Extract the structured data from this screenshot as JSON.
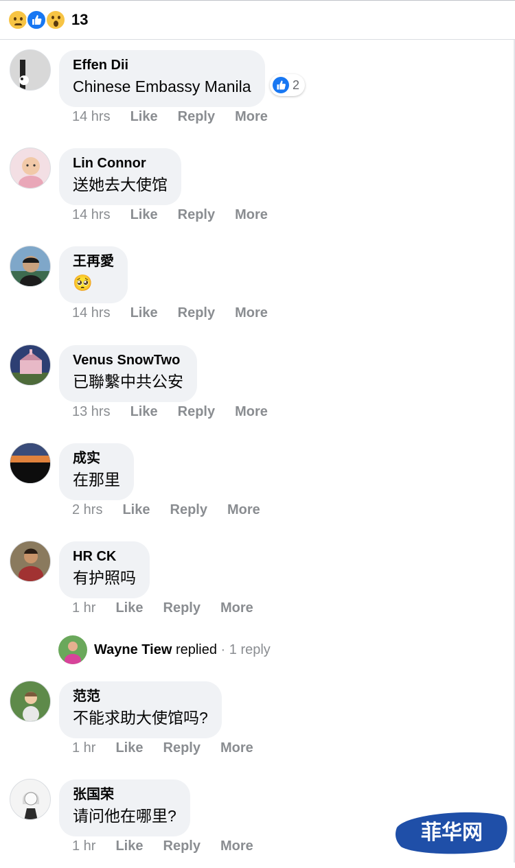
{
  "reactions": {
    "icons": [
      "sad-icon",
      "like-icon",
      "wow-icon"
    ],
    "count": "13"
  },
  "comments": [
    {
      "name": "Effen Dii",
      "text": "Chinese Embassy Manila",
      "time": "14 hrs",
      "like": "Like",
      "reply": "Reply",
      "more": "More",
      "reaction_count": "2"
    },
    {
      "name": "Lin Connor",
      "text": "送她去大使馆",
      "time": "14 hrs",
      "like": "Like",
      "reply": "Reply",
      "more": "More"
    },
    {
      "name": "王再愛",
      "text": "🥺",
      "time": "14 hrs",
      "like": "Like",
      "reply": "Reply",
      "more": "More"
    },
    {
      "name": "Venus SnowTwo",
      "text": "已聯繫中共公安",
      "time": "13 hrs",
      "like": "Like",
      "reply": "Reply",
      "more": "More"
    },
    {
      "name": "成实",
      "text": "在那里",
      "time": "2 hrs",
      "like": "Like",
      "reply": "Reply",
      "more": "More"
    },
    {
      "name": "HR CK",
      "text": "有护照吗",
      "time": "1 hr",
      "like": "Like",
      "reply": "Reply",
      "more": "More"
    },
    {
      "name": "范范",
      "text": "不能求助大使馆吗?",
      "time": "1 hr",
      "like": "Like",
      "reply": "Reply",
      "more": "More"
    },
    {
      "name": "张国荣",
      "text": "请问他在哪里?",
      "time": "1 hr",
      "like": "Like",
      "reply": "Reply",
      "more": "More"
    }
  ],
  "reply_thread": {
    "name": "Wayne Tiew",
    "action": "replied",
    "sep": "·",
    "count": "1 reply"
  },
  "watermark": {
    "text": "菲华网",
    "color": "#1f4fa8"
  },
  "colors": {
    "bubble": "#f0f2f5",
    "meta": "#8a8d91",
    "like_blue": "#1877f2"
  }
}
